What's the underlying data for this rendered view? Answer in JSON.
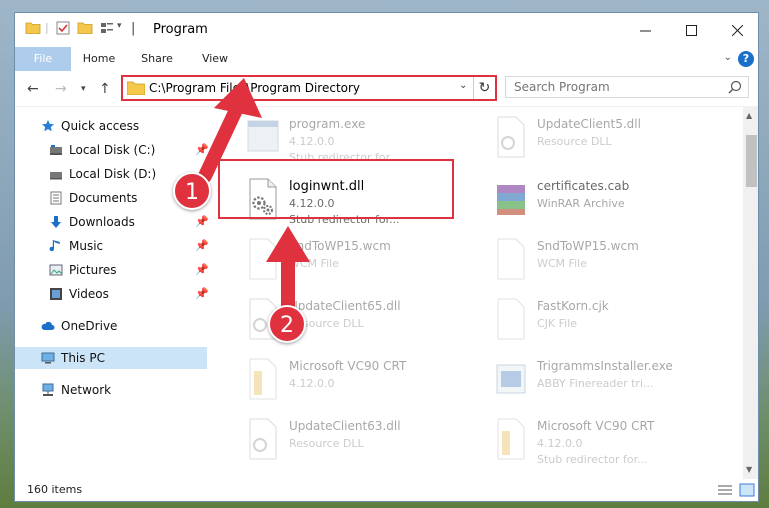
{
  "window": {
    "title": "Program"
  },
  "ribbon": {
    "tabs": [
      "File",
      "Home",
      "Share",
      "View"
    ],
    "help": "?"
  },
  "address": {
    "path": "C:\\Program Files\\Program Directory"
  },
  "search": {
    "placeholder": "Search Program"
  },
  "nav": {
    "items": [
      {
        "label": "Quick access",
        "icon": "star-icon",
        "pinned": false
      },
      {
        "label": "Local Disk (C:)",
        "icon": "drive-icon",
        "pinned": true
      },
      {
        "label": "Local Disk (D:)",
        "icon": "drive-icon",
        "pinned": false
      },
      {
        "label": "Documents",
        "icon": "documents-icon",
        "pinned": true
      },
      {
        "label": "Downloads",
        "icon": "download-icon",
        "pinned": true
      },
      {
        "label": "Music",
        "icon": "music-icon",
        "pinned": true
      },
      {
        "label": "Pictures",
        "icon": "pictures-icon",
        "pinned": true
      },
      {
        "label": "Videos",
        "icon": "videos-icon",
        "pinned": true
      },
      {
        "label": "OneDrive",
        "icon": "cloud-icon",
        "pinned": false
      },
      {
        "label": "This PC",
        "icon": "pc-icon",
        "pinned": false,
        "selected": true
      },
      {
        "label": "Network",
        "icon": "network-icon",
        "pinned": false
      }
    ]
  },
  "files": [
    {
      "name": "program.exe",
      "meta1": "4.12.0.0",
      "meta2": "Stub redirector for...",
      "icon": "exe-icon"
    },
    {
      "name": "UpdateClient5.dll",
      "meta1": "Resource DLL",
      "meta2": "",
      "icon": "dll-icon"
    },
    {
      "name": "loginwnt.dll",
      "meta1": "4.12.0.0",
      "meta2": "Stub redirector for...",
      "icon": "dll-gear-icon",
      "focus": true
    },
    {
      "name": "certificates.cab",
      "meta1": "WinRAR Archive",
      "meta2": "",
      "icon": "archive-icon"
    },
    {
      "name": "SndToWP15.wcm",
      "meta1": "WCM File",
      "meta2": "",
      "icon": "blank-file-icon"
    },
    {
      "name": "SndToWP15.wcm",
      "meta1": "WCM File",
      "meta2": "",
      "icon": "blank-file-icon"
    },
    {
      "name": "UpdateClient65.dll",
      "meta1": "Resource DLL",
      "meta2": "",
      "icon": "dll-icon"
    },
    {
      "name": "FastKorn.cjk",
      "meta1": "CJK File",
      "meta2": "",
      "icon": "blank-file-icon"
    },
    {
      "name": "Microsoft VC90 CRT",
      "meta1": "4.12.0.0",
      "meta2": "",
      "icon": "manifest-icon"
    },
    {
      "name": "TrigrammsInstaller.exe",
      "meta1": "ABBY Finereader tri...",
      "meta2": "",
      "icon": "installer-icon"
    },
    {
      "name": "UpdateClient63.dll",
      "meta1": "Resource DLL",
      "meta2": "",
      "icon": "dll-icon"
    },
    {
      "name": "Microsoft VC90 CRT",
      "meta1": "4.12.0.0",
      "meta2": "Stub redirector for...",
      "icon": "manifest-icon"
    }
  ],
  "status": {
    "count": "160 items"
  },
  "markers": {
    "one": "1",
    "two": "2"
  },
  "colors": {
    "accent": "#1a6fc9",
    "highlight": "#e0313e",
    "selected": "#cce4f7"
  }
}
